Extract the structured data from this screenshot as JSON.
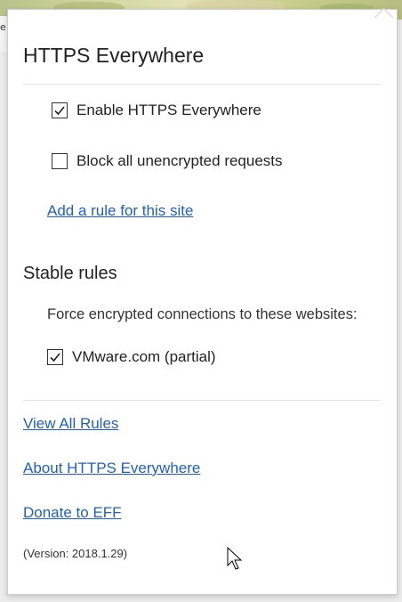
{
  "popup": {
    "title": "HTTPS Everywhere",
    "enable": {
      "label": "Enable HTTPS Everywhere",
      "checked": true
    },
    "block": {
      "label": "Block all unencrypted requests",
      "checked": false
    },
    "add_rule_link": "Add a rule for this site"
  },
  "stable_rules": {
    "title": "Stable rules",
    "description": "Force encrypted connections to these websites:",
    "items": [
      {
        "label": "VMware.com (partial)",
        "checked": true
      }
    ]
  },
  "footer": {
    "view_all": "View All Rules",
    "about": "About HTTPS Everywhere",
    "donate": "Donate to EFF",
    "version": "(Version: 2018.1.29)"
  },
  "colors": {
    "link": "#1f5fc9",
    "text": "#222222"
  }
}
